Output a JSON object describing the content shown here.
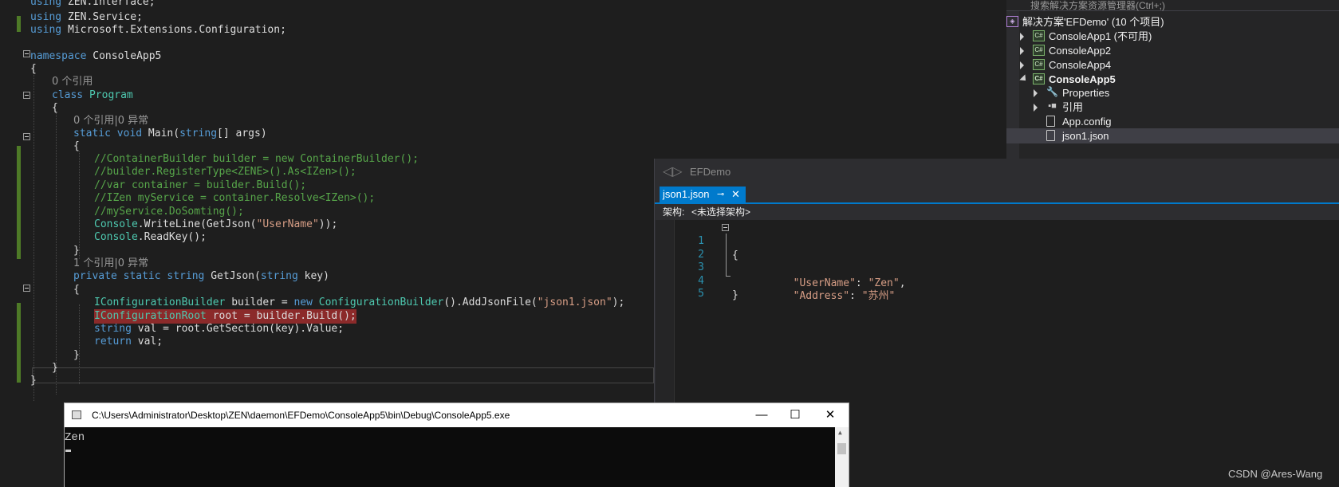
{
  "editor": {
    "lines": [
      {
        "parts": [
          {
            "c": "kw",
            "t": "using"
          },
          {
            "c": "pl",
            "t": " ZEN.Interface;"
          }
        ]
      },
      {
        "parts": [
          {
            "c": "kw",
            "t": "using"
          },
          {
            "c": "pl",
            "t": " ZEN.Service;"
          }
        ]
      },
      {
        "parts": [
          {
            "c": "kw",
            "t": "using"
          },
          {
            "c": "pl",
            "t": " Microsoft.Extensions.Configuration;"
          }
        ]
      },
      {
        "parts": [
          {
            "c": "kw",
            "t": "namespace"
          },
          {
            "c": "pl",
            "t": " ConsoleApp5"
          }
        ]
      },
      {
        "parts": [
          {
            "c": "pl",
            "t": "{"
          }
        ]
      },
      {
        "parts": [
          {
            "c": "ref",
            "t": "0 个引用"
          }
        ]
      },
      {
        "parts": [
          {
            "c": "kw",
            "t": "class"
          },
          {
            "c": "pl",
            "t": " "
          },
          {
            "c": "ty",
            "t": "Program"
          }
        ]
      },
      {
        "parts": [
          {
            "c": "pl",
            "t": "{"
          }
        ]
      },
      {
        "parts": [
          {
            "c": "ref",
            "t": "0 个引用|0 异常"
          }
        ]
      },
      {
        "parts": [
          {
            "c": "kw",
            "t": "static"
          },
          {
            "c": "pl",
            "t": " "
          },
          {
            "c": "kw",
            "t": "void"
          },
          {
            "c": "pl",
            "t": " Main("
          },
          {
            "c": "kw",
            "t": "string"
          },
          {
            "c": "pl",
            "t": "[] args)"
          }
        ]
      },
      {
        "parts": [
          {
            "c": "pl",
            "t": "{"
          }
        ]
      },
      {
        "parts": [
          {
            "c": "cm",
            "t": "//ContainerBuilder builder = new ContainerBuilder();"
          }
        ]
      },
      {
        "parts": [
          {
            "c": "cm",
            "t": "//builder.RegisterType<ZENE>().As<IZen>();"
          }
        ]
      },
      {
        "parts": [
          {
            "c": "cm",
            "t": "//var container = builder.Build();"
          }
        ]
      },
      {
        "parts": [
          {
            "c": "cm",
            "t": "//IZen myService = container.Resolve<IZen>();"
          }
        ]
      },
      {
        "parts": [
          {
            "c": "cm",
            "t": "//myService.DoSomting();"
          }
        ]
      },
      {
        "parts": [
          {
            "c": "ty",
            "t": "Console"
          },
          {
            "c": "pl",
            "t": ".WriteLine(GetJson("
          },
          {
            "c": "st",
            "t": "\"UserName\""
          },
          {
            "c": "pl",
            "t": "));"
          }
        ]
      },
      {
        "parts": [
          {
            "c": "ty",
            "t": "Console"
          },
          {
            "c": "pl",
            "t": ".ReadKey();"
          }
        ]
      },
      {
        "parts": [
          {
            "c": "pl",
            "t": "}"
          }
        ]
      },
      {
        "parts": [
          {
            "c": "ref",
            "t": "1 个引用|0 异常"
          }
        ]
      },
      {
        "parts": [
          {
            "c": "kw",
            "t": "private"
          },
          {
            "c": "pl",
            "t": " "
          },
          {
            "c": "kw",
            "t": "static"
          },
          {
            "c": "pl",
            "t": " "
          },
          {
            "c": "kw",
            "t": "string"
          },
          {
            "c": "pl",
            "t": " GetJson("
          },
          {
            "c": "kw",
            "t": "string"
          },
          {
            "c": "pl",
            "t": " key)"
          }
        ]
      },
      {
        "parts": [
          {
            "c": "pl",
            "t": "{"
          }
        ]
      },
      {
        "parts": [
          {
            "c": "ty",
            "t": "IConfigurationBuilder"
          },
          {
            "c": "pl",
            "t": " builder = "
          },
          {
            "c": "kw",
            "t": "new"
          },
          {
            "c": "pl",
            "t": " "
          },
          {
            "c": "ty",
            "t": "ConfigurationBuilder"
          },
          {
            "c": "pl",
            "t": "().AddJsonFile("
          },
          {
            "c": "st",
            "t": "\"json1.json\""
          },
          {
            "c": "pl",
            "t": ");"
          }
        ]
      },
      {
        "parts": [
          {
            "c": "ty",
            "t": "IConfigurationRoot"
          },
          {
            "c": "pl",
            "t": " root = builder.Build();"
          }
        ],
        "highlight": true
      },
      {
        "parts": [
          {
            "c": "kw",
            "t": "string"
          },
          {
            "c": "pl",
            "t": " val = root.GetSection(key).Value;"
          }
        ]
      },
      {
        "parts": [
          {
            "c": "kw",
            "t": "return"
          },
          {
            "c": "pl",
            "t": " val;"
          }
        ]
      },
      {
        "parts": [
          {
            "c": "pl",
            "t": "}"
          }
        ]
      },
      {
        "parts": [
          {
            "c": "pl",
            "t": "}"
          }
        ]
      },
      {
        "parts": [
          {
            "c": "pl",
            "t": "}"
          }
        ]
      }
    ]
  },
  "solution_explorer": {
    "search_placeholder": "搜索解决方案资源管理器(Ctrl+;)",
    "items": [
      {
        "label": "解决方案'EFDemo' (10 个项目)",
        "icon": "solution-icon",
        "glyph": "◈"
      },
      {
        "label": "ConsoleApp1 (不可用)",
        "icon": "project-unavailable-icon",
        "glyph": "C#"
      },
      {
        "label": "ConsoleApp2",
        "icon": "csharp-project-icon",
        "glyph": "C#"
      },
      {
        "label": "ConsoleApp4",
        "icon": "csharp-project-icon",
        "glyph": "C#"
      },
      {
        "label": "ConsoleApp5",
        "icon": "csharp-project-icon",
        "glyph": "C#"
      },
      {
        "label": "Properties",
        "icon": "wrench-icon",
        "glyph": "🔧"
      },
      {
        "label": "引用",
        "icon": "references-icon",
        "glyph": "▪■"
      },
      {
        "label": "App.config",
        "icon": "config-file-icon",
        "glyph": ""
      },
      {
        "label": "json1.json",
        "icon": "json-file-icon",
        "glyph": ""
      }
    ]
  },
  "json_window": {
    "title": "EFDemo",
    "tab_label": "json1.json",
    "pin_glyph": "⊸",
    "close_glyph": "✕",
    "schema_label": "架构:",
    "schema_value": "<未选择架构>",
    "line_numbers": [
      "1",
      "2",
      "3",
      "4",
      "5"
    ],
    "open_brace": "{",
    "close_brace": "}",
    "entries": [
      {
        "key": "\"UserName\"",
        "sep": ": ",
        "value": "\"Zen\"",
        "trail": ","
      },
      {
        "key": "\"Address\"",
        "sep": ": ",
        "value": "\"苏州\"",
        "trail": ""
      }
    ]
  },
  "console": {
    "title": "C:\\Users\\Administrator\\Desktop\\ZEN\\daemon\\EFDemo\\ConsoleApp5\\bin\\Debug\\ConsoleApp5.exe",
    "output": "Zen",
    "minimize_glyph": "—",
    "maximize_glyph": "☐",
    "close_glyph": "✕",
    "scroll_up_glyph": "▲"
  },
  "watermark": "CSDN @Ares-Wang",
  "colors": {
    "keyword": "#569cd6",
    "type": "#4ec9b0",
    "string": "#d69d85",
    "comment": "#57a64a",
    "tab_active": "#007acc",
    "breakpoint_highlight": "#8b2a2a"
  }
}
